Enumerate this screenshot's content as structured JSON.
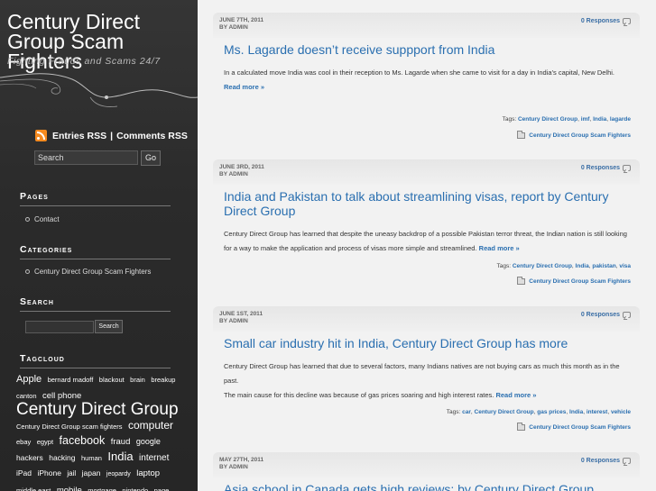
{
  "site": {
    "title": "Century Direct Group Scam Fighters",
    "tagline": "Fighting Frauds and Scams 24/7"
  },
  "rss": {
    "entries": "Entries RSS",
    "separator": "|",
    "comments": "Comments RSS"
  },
  "search_top": {
    "value": "Search",
    "button": "Go"
  },
  "widgets": {
    "pages": {
      "title": "Pages",
      "items": [
        "Contact"
      ]
    },
    "categories": {
      "title": "Categories",
      "items": [
        "Century Direct Group Scam Fighters"
      ]
    },
    "search": {
      "title": "Search",
      "button": "Search"
    },
    "tagcloud": {
      "title": "Tagcloud",
      "tags": [
        {
          "text": "Apple",
          "size": 11
        },
        {
          "text": "bernard madoff",
          "size": 7.5
        },
        {
          "text": "blackout",
          "size": 7.5
        },
        {
          "text": "brain",
          "size": 7.5
        },
        {
          "text": "breakup",
          "size": 7.5
        },
        {
          "text": "canton",
          "size": 7.5
        },
        {
          "text": "cell phone",
          "size": 9.5
        },
        {
          "text": "Century Direct Group",
          "size": 19
        },
        {
          "text": "Century Direct Group scam fighters",
          "size": 7.5
        },
        {
          "text": "computer",
          "size": 12
        },
        {
          "text": "ebay",
          "size": 7.5
        },
        {
          "text": "egypt",
          "size": 7.5
        },
        {
          "text": "facebook",
          "size": 12.5
        },
        {
          "text": "fraud",
          "size": 9.5
        },
        {
          "text": "google",
          "size": 9
        },
        {
          "text": "hackers",
          "size": 8.5
        },
        {
          "text": "hacking",
          "size": 8.5
        },
        {
          "text": "human",
          "size": 7.5
        },
        {
          "text": "India",
          "size": 13
        },
        {
          "text": "internet",
          "size": 10
        },
        {
          "text": "iPad",
          "size": 8.5
        },
        {
          "text": "iPhone",
          "size": 8.5
        },
        {
          "text": "jail",
          "size": 8
        },
        {
          "text": "japan",
          "size": 8.5
        },
        {
          "text": "jeopardy",
          "size": 7
        },
        {
          "text": "laptop",
          "size": 9.5
        },
        {
          "text": "middle east",
          "size": 7.5
        },
        {
          "text": "mobile",
          "size": 9.5
        },
        {
          "text": "mortgage",
          "size": 7.5
        },
        {
          "text": "nintendo",
          "size": 7.5
        },
        {
          "text": "page",
          "size": 7.5
        }
      ]
    }
  },
  "posts": [
    {
      "date": "June 7th, 2011",
      "author": "By Admin",
      "responses": "0 Responses",
      "title": "Ms. Lagarde doesn’t receive suppport from India",
      "body": "In a calculated move India was cool in their reception to Ms. Lagarde when she came to visit for a day in India’s capital, New Delhi.",
      "read_more": "Read more »",
      "tags_label": "Tags:",
      "tags": [
        "Century Direct Group",
        "imf",
        "India",
        "lagarde"
      ],
      "category": "Century Direct Group Scam Fighters"
    },
    {
      "date": "June 3rd, 2011",
      "author": "By Admin",
      "responses": "0 Responses",
      "title": "India and Pakistan to talk about streamlining visas, report by Century Direct Group",
      "body": "Century Direct Group  has learned that despite the uneasy backdrop of a possible Pakistan terror threat, the Indian nation is still looking for a way to make the application and process of visas more simple and streamlined.",
      "read_more": "Read more »",
      "tags_label": "Tags:",
      "tags": [
        "Century Direct Group",
        "India",
        "pakistan",
        "visa"
      ],
      "category": "Century Direct Group Scam Fighters"
    },
    {
      "date": "June 1st, 2011",
      "author": "By Admin",
      "responses": "0 Responses",
      "title": "Small car industry hit in India, Century Direct Group has more",
      "body": "Century Direct Group has learned that due to several factors, many Indians natives are not buying cars as much this month as in the past.",
      "body2": "The main cause for this decline was because of gas prices soaring and high interest rates.",
      "read_more": "Read more »",
      "tags_label": "Tags:",
      "tags": [
        "car",
        "Century Direct Group",
        "gas prices",
        "India",
        "interest",
        "vehicle"
      ],
      "category": "Century Direct Group Scam Fighters"
    },
    {
      "date": "May 27th, 2011",
      "author": "By Admin",
      "responses": "0 Responses",
      "title": "Asia school in Canada gets high reviews; by Century Direct Group"
    }
  ]
}
